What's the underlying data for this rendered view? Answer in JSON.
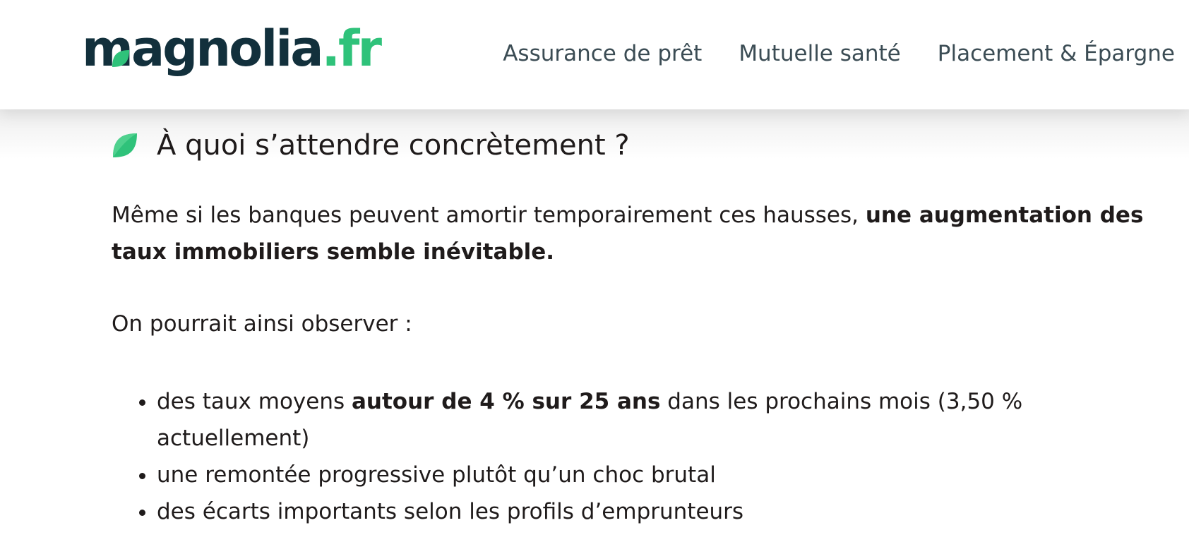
{
  "header": {
    "logo": {
      "main": "magnolia",
      "dot": ".",
      "tld": "fr"
    },
    "nav": [
      {
        "label": "Assurance de prêt"
      },
      {
        "label": "Mutuelle santé"
      },
      {
        "label": "Placement & Épargne"
      }
    ]
  },
  "article": {
    "heading": "À quoi s’attendre concrètement ?",
    "paragraph1": {
      "text": "Même si les banques peuvent amortir temporairement ces hausses, ",
      "bold": "une augmentation des taux immobiliers semble inévitable."
    },
    "paragraph2": "On pourrait ainsi observer :",
    "list": [
      {
        "pre": "des taux moyens ",
        "bold": "autour de 4 % sur 25 ans",
        "post": " dans les prochains mois (3,50 % actuellement)"
      },
      {
        "pre": "une remontée progressive plutôt qu’un choc brutal",
        "bold": "",
        "post": ""
      },
      {
        "pre": "des écarts importants selon les profils d’emprunteurs",
        "bold": "",
        "post": ""
      }
    ]
  },
  "colors": {
    "brand_dark": "#12303c",
    "brand_green": "#2fc27a",
    "nav_text": "#3b4c54"
  },
  "icons": {
    "logo_leaf": "leaf-icon",
    "heading_leaf": "leaf-icon"
  }
}
